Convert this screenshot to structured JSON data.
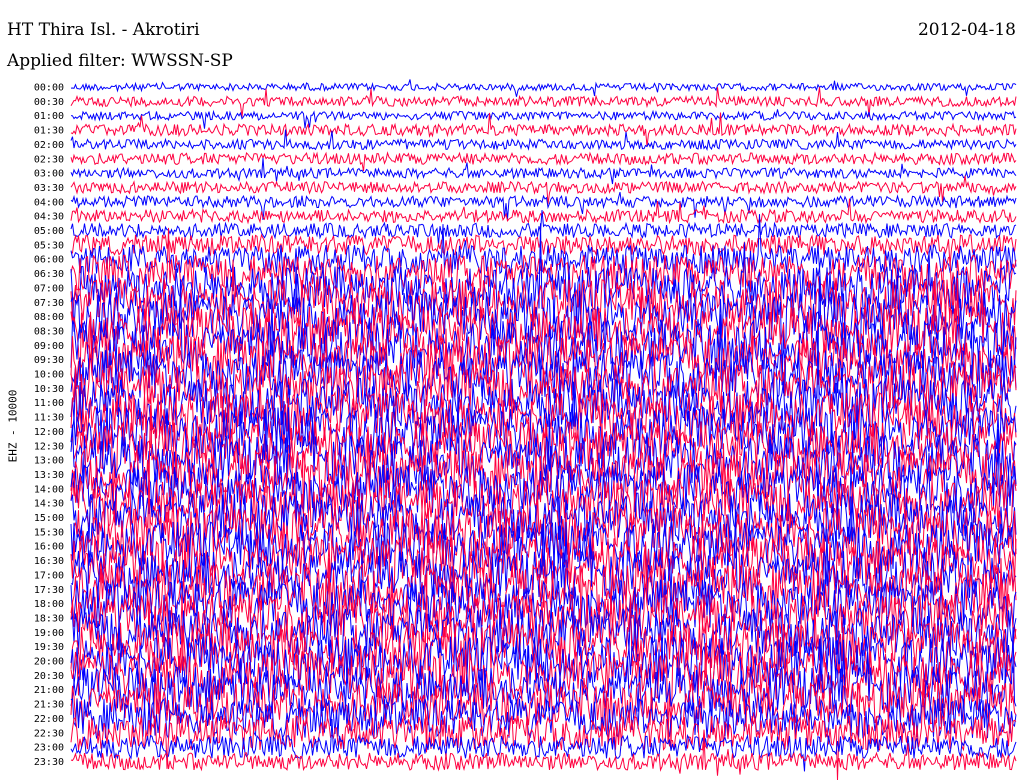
{
  "header": {
    "station": "HT Thira Isl. - Akrotiri",
    "date": "2012-04-18",
    "filter": "Applied filter: WWSSN-SP"
  },
  "chart_data": {
    "type": "line",
    "ylabel": "EHZ - 10000",
    "row_labels": [
      "00:00",
      "00:30",
      "01:00",
      "01:30",
      "02:00",
      "02:30",
      "03:00",
      "03:30",
      "04:00",
      "04:30",
      "05:00",
      "05:30",
      "06:00",
      "06:30",
      "07:00",
      "07:30",
      "08:00",
      "08:30",
      "09:00",
      "09:30",
      "10:00",
      "10:30",
      "11:00",
      "11:30",
      "12:00",
      "12:30",
      "13:00",
      "13:30",
      "14:00",
      "14:30",
      "15:00",
      "15:30",
      "16:00",
      "16:30",
      "17:00",
      "17:30",
      "18:00",
      "18:30",
      "19:00",
      "19:30",
      "20:00",
      "20:30",
      "21:00",
      "21:30",
      "22:00",
      "22:30",
      "23:00",
      "23:30"
    ],
    "row_colors": [
      "#0000ff",
      "#ff0040"
    ],
    "row_amplitude": [
      0.5,
      0.7,
      0.6,
      0.8,
      0.7,
      0.8,
      0.7,
      0.8,
      0.8,
      0.9,
      1.0,
      1.4,
      2.0,
      2.6,
      3.0,
      3.2,
      3.4,
      3.4,
      3.4,
      3.4,
      3.4,
      3.4,
      3.4,
      3.4,
      3.4,
      3.4,
      3.4,
      3.4,
      3.4,
      3.4,
      3.4,
      3.4,
      3.4,
      3.4,
      3.4,
      3.4,
      3.4,
      3.4,
      3.4,
      3.4,
      3.4,
      3.4,
      3.2,
      3.0,
      2.8,
      2.4,
      1.6,
      1.2
    ]
  }
}
